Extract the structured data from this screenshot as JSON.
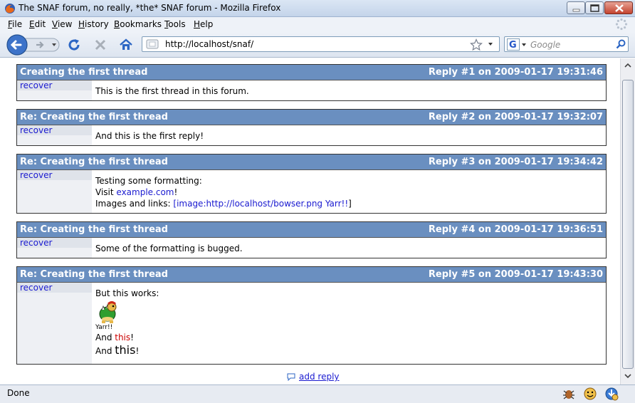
{
  "window": {
    "title": "The SNAF forum, no really, *the* SNAF forum - Mozilla Firefox"
  },
  "menu": [
    {
      "key": "F",
      "rest": "ile"
    },
    {
      "key": "E",
      "rest": "dit"
    },
    {
      "key": "V",
      "rest": "iew"
    },
    {
      "key": "H",
      "rest": "istory"
    },
    {
      "key": "B",
      "rest": "ookmarks"
    },
    {
      "key": "T",
      "rest": "ools"
    },
    {
      "key": "H",
      "rest": "elp"
    }
  ],
  "nav": {
    "url": "http://localhost/snaf/",
    "search_placeholder": "Google"
  },
  "posts": [
    {
      "subject": "Creating the first thread",
      "meta": "Reply #1 on 2009-01-17 19:31:46",
      "author": "recover",
      "line1": "This is the first thread in this forum."
    },
    {
      "subject": "Re: Creating the first thread",
      "meta": "Reply #2 on 2009-01-17 19:32:07",
      "author": "recover",
      "line1": "And this is the first reply!"
    },
    {
      "subject": "Re: Creating the first thread",
      "meta": "Reply #3 on 2009-01-17 19:34:42",
      "author": "recover",
      "line1": "Testing some formatting:",
      "visit_prefix": "Visit ",
      "visit_link": "example.com",
      "visit_suffix": "!",
      "images_prefix": "Images and links: ",
      "images_open": "[",
      "images_link": "image:http://localhost/bowser.png Yarr!!",
      "images_close": "]"
    },
    {
      "subject": "Re: Creating the first thread",
      "meta": "Reply #4 on 2009-01-17 19:36:51",
      "author": "recover",
      "line1": "Some of the formatting is bugged."
    },
    {
      "subject": "Re: Creating the first thread",
      "meta": "Reply #5 on 2009-01-17 19:43:30",
      "author": "recover",
      "line1": "But this works:",
      "caption": "Yarr!!",
      "and": "And ",
      "this": "this",
      "bang": "!"
    }
  ],
  "add_reply": "add reply",
  "status": {
    "text": "Done"
  },
  "icons": [
    "firefox-icon",
    "back-icon",
    "forward-icon",
    "reload-icon",
    "stop-icon",
    "home-icon",
    "star-icon",
    "google-icon",
    "search-icon",
    "bowser-icon",
    "bug-icon",
    "smiley-icon",
    "update-icon"
  ],
  "colors": {
    "post_header": "#6a8fc0",
    "link": "#1a1ad0",
    "red_text": "#cc0000"
  }
}
